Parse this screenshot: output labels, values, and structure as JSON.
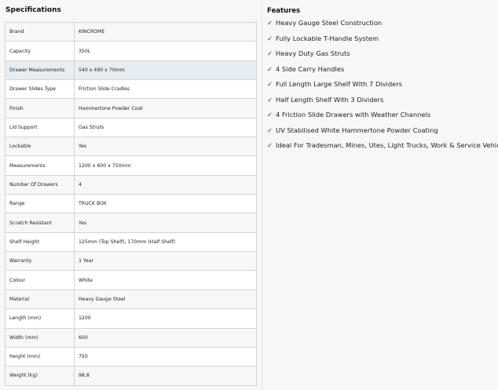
{
  "specifications": {
    "title": "Specifications",
    "rows": [
      {
        "label": "Brand",
        "value": "KINCROME"
      },
      {
        "label": "Capacity",
        "value": "350L"
      },
      {
        "label": "Drawer Measurements",
        "value": "540 x 490 x 70mm"
      },
      {
        "label": "Drawer Slides Type",
        "value": "Friction Slide Cradles"
      },
      {
        "label": "Finish",
        "value": "Hammertone Powder Coat"
      },
      {
        "label": "Lid Support",
        "value": "Gas Struts"
      },
      {
        "label": "Lockable",
        "value": "Yes"
      },
      {
        "label": "Measurements",
        "value": "1200 x 600 x 750mm"
      },
      {
        "label": "Number Of Drawers",
        "value": "4"
      },
      {
        "label": "Range",
        "value": "TRUCK BOX"
      },
      {
        "label": "Scratch Resistant",
        "value": "Yes"
      },
      {
        "label": "Shelf Height",
        "value": "125mm (Top Shelf), 170mm (Half Shelf)"
      },
      {
        "label": "Warranty",
        "value": "1 Year"
      },
      {
        "label": "Colour",
        "value": "White"
      },
      {
        "label": "Material",
        "value": "Heavy Gauge Steel"
      },
      {
        "label": "Length (mm)",
        "value": "1200"
      },
      {
        "label": "Width (mm)",
        "value": "600"
      },
      {
        "label": "Height (mm)",
        "value": "750"
      },
      {
        "label": "Weight (kg)",
        "value": "98.8"
      }
    ]
  },
  "features": {
    "title": "Features",
    "check_glyph": "✓",
    "items": [
      "Heavy Gauge Steel Construction",
      "Fully Lockable T-Handle System",
      "Heavy Duty Gas Struts",
      "4 Side Carry Handles",
      "Full Length Large Shelf With 7 Dividers",
      "Half Length Shelf With 3 Dividers",
      "4 Friction Slide Drawers with Weather Channels",
      "UV Stabilised White Hammertone Powder Coating",
      "Ideal For Tradesman, Mines, Utes, Light Trucks, Work & Service Vehicles"
    ]
  }
}
